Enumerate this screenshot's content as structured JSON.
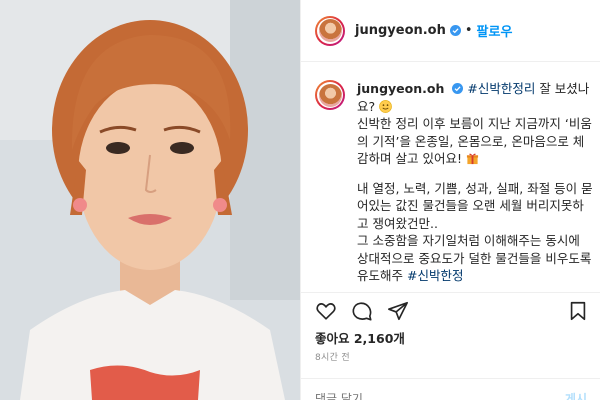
{
  "post": {
    "username": "jungyeon.oh",
    "follow_label": "팔로우",
    "dot": "•",
    "caption": {
      "hashtag1": "#신박한정리",
      "line_intro": "잘 보셨나요?",
      "para1": "신박한 정리 이후 보름이 지난 지금까지 ‘비움의 기적’을 온종일, 온몸으로, 온마음으로 체감하며 살고 있어요!",
      "para2": "내 열정, 노력, 기쁨, 성과, 실패, 좌절 등이 묻어있는 값진 물건들을 오랜 세월 버리지못하고 쟁여왔건만..",
      "para3": "그 소중함을 자기일처럼 이해해주는 동시에 상대적으로 중요도가 덜한 물건들을 비우도록 유도해주",
      "hashtag2": "#신박한정"
    },
    "likes": "좋아요 2,160개",
    "time": "8시간 전",
    "comment_placeholder": "댓글 달기...",
    "post_label": "게시"
  },
  "icons": {
    "verified": "verified-badge-icon",
    "heart": "heart-icon",
    "comment": "comment-icon",
    "share": "share-icon",
    "save": "bookmark-icon",
    "smile": "smiling-face-emoji",
    "gift": "gift-emoji"
  },
  "colors": {
    "accent": "#0095f6",
    "hashtag": "#00376b",
    "muted": "#8e8e8e"
  }
}
